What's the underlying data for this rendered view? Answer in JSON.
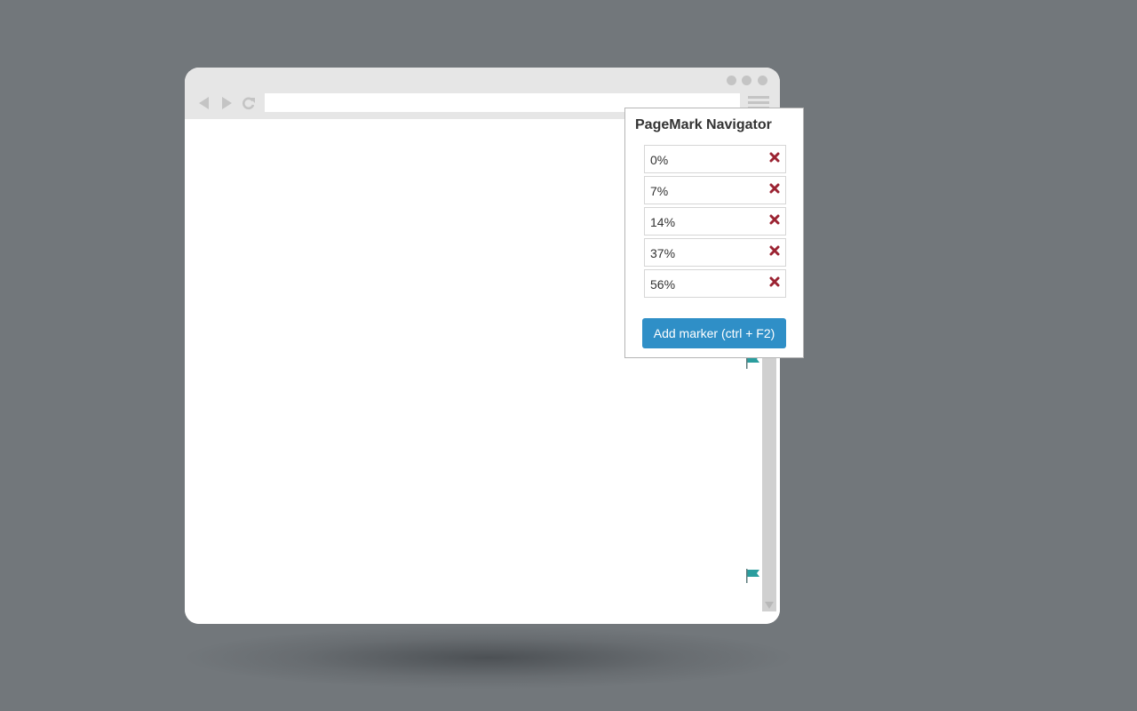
{
  "popup": {
    "title": "PageMark Navigator",
    "markers": [
      {
        "label": "0%"
      },
      {
        "label": "7%"
      },
      {
        "label": "14%"
      },
      {
        "label": "37%"
      },
      {
        "label": "56%"
      }
    ],
    "add_button_label": "Add marker (ctrl + F2)"
  },
  "icons": {
    "back": "triangle-left-icon",
    "forward": "triangle-right-icon",
    "reload": "reload-icon",
    "menu": "hamburger-menu-icon",
    "remove": "x-mark-icon",
    "flag": "flag-icon"
  },
  "colors": {
    "backdrop": "#72777b",
    "accent_button": "#2f8fc7",
    "remove_icon": "#9b2332",
    "flag": "#2a9d9e"
  }
}
